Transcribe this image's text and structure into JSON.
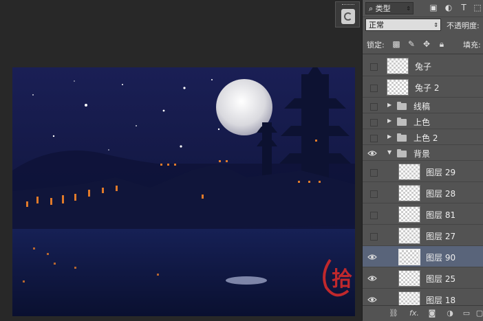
{
  "filter": {
    "label": "类型",
    "search_glyph": "⌕"
  },
  "blend": {
    "mode": "正常",
    "opacity_label": "不透明度:"
  },
  "lock": {
    "label": "锁定:",
    "fill_label": "填充:"
  },
  "layers": [
    {
      "name": "兔子",
      "kind": "layer",
      "visible": false,
      "indent": false
    },
    {
      "name": "兔子 2",
      "kind": "layer",
      "visible": false,
      "indent": false
    },
    {
      "name": "线稿",
      "kind": "group",
      "expanded": false,
      "visible": false
    },
    {
      "name": "上色",
      "kind": "group",
      "expanded": false,
      "visible": false
    },
    {
      "name": "上色 2",
      "kind": "group",
      "expanded": false,
      "visible": false
    },
    {
      "name": "背景",
      "kind": "group",
      "expanded": true,
      "visible": true
    },
    {
      "name": "图层 29",
      "kind": "layer",
      "visible": false,
      "indent": true
    },
    {
      "name": "图层 28",
      "kind": "layer",
      "visible": false,
      "indent": true
    },
    {
      "name": "图层 81",
      "kind": "layer",
      "visible": false,
      "indent": true
    },
    {
      "name": "图层 27",
      "kind": "layer",
      "visible": false,
      "indent": true
    },
    {
      "name": "图层 90",
      "kind": "layer",
      "visible": true,
      "indent": true,
      "selected": true
    },
    {
      "name": "图层 25",
      "kind": "layer",
      "visible": true,
      "indent": true
    },
    {
      "name": "图层 18",
      "kind": "layer",
      "visible": true,
      "indent": true
    }
  ],
  "footer_icons": [
    "link-icon",
    "fx-icon",
    "mask-icon",
    "adjustment-icon",
    "new-group-icon",
    "new-layer-icon"
  ],
  "footer_fx_label": "fx.",
  "artwork": {
    "seal_text": "拾"
  },
  "colors": {
    "panel": "#535353",
    "selected": "#59647a",
    "background": "#282828",
    "night_sky": "#0b1030",
    "seal": "#c0282c"
  }
}
